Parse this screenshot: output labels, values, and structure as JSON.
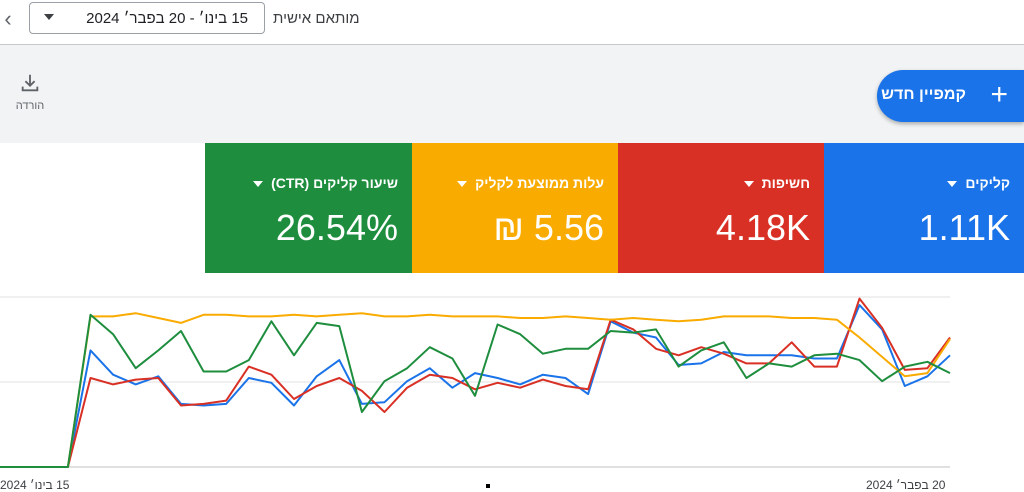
{
  "topbar": {
    "back_icon": "chevron-left-icon",
    "date_range_value": "15 בינו׳ - 20 בפבר׳ 2024",
    "date_range_label": "מותאם אישית"
  },
  "toolbar": {
    "download_label": "הורדה",
    "new_campaign_label": "קמפיין חדש"
  },
  "colors": {
    "clicks": "#1a73e8",
    "impressions": "#d93025",
    "avg_cpc": "#f9ab00",
    "ctr": "#1e8e3e"
  },
  "metrics": [
    {
      "key": "clicks",
      "label": "קליקים",
      "value": "1.11K",
      "color": "#1a73e8"
    },
    {
      "key": "impressions",
      "label": "חשיפות",
      "value": "4.18K",
      "color": "#d93025"
    },
    {
      "key": "avg_cpc",
      "label": "עלות ממוצעת לקליק",
      "value": "5.56 ₪",
      "color": "#f9ab00"
    },
    {
      "key": "ctr",
      "label": "שיעור קליקים (CTR)",
      "value": "26.54%",
      "color": "#1e8e3e"
    }
  ],
  "chart": {
    "x_start_label": "15 בינו׳ 2024",
    "x_end_label": "20 בפבר׳ 2024"
  },
  "chart_data": {
    "type": "line",
    "x_labels": [
      "15 בינו׳ 2024",
      "20 בפבר׳ 2024"
    ],
    "series": [
      {
        "name": "קליקים",
        "color": "#1a73e8",
        "values": [
          0,
          0,
          0,
          0,
          72,
          57,
          51,
          56,
          39,
          38,
          39,
          55,
          52,
          38,
          56,
          66,
          39,
          40,
          53,
          61,
          49,
          58,
          55,
          51,
          57,
          55,
          45,
          90,
          83,
          80,
          63,
          64,
          71,
          69,
          69,
          69,
          67,
          67,
          100,
          85,
          50,
          56,
          69
        ]
      },
      {
        "name": "חשיפות",
        "color": "#d93025",
        "values": [
          0,
          0,
          0,
          0,
          55,
          51,
          54,
          55,
          38,
          39,
          41,
          62,
          57,
          42,
          50,
          55,
          47,
          34,
          49,
          57,
          55,
          48,
          52,
          49,
          54,
          50,
          48,
          91,
          85,
          73,
          69,
          74,
          70,
          64,
          64,
          77,
          62,
          62,
          104,
          86,
          60,
          61,
          80
        ]
      },
      {
        "name": "עלות ממוצעת לקליק",
        "color": "#f9ab00",
        "values": [
          0,
          0,
          0,
          0,
          93,
          93,
          95,
          92,
          89,
          94,
          94,
          93,
          93,
          94,
          93,
          94,
          95,
          93,
          93,
          94,
          93,
          93,
          93,
          92,
          92,
          93,
          92,
          91,
          92,
          91,
          90,
          91,
          93,
          93,
          93,
          92,
          92,
          91,
          80,
          68,
          56,
          58,
          79
        ]
      },
      {
        "name": "שיעור קליקים (CTR)",
        "color": "#1e8e3e",
        "values": [
          0,
          0,
          0,
          0,
          94,
          82,
          61,
          72,
          84,
          59,
          59,
          66,
          90,
          69,
          89,
          87,
          34,
          53,
          61,
          74,
          67,
          44,
          88,
          82,
          70,
          73,
          73,
          84,
          83,
          85,
          62,
          72,
          77,
          55,
          64,
          62,
          69,
          70,
          66,
          53,
          62,
          65,
          58
        ]
      }
    ]
  }
}
